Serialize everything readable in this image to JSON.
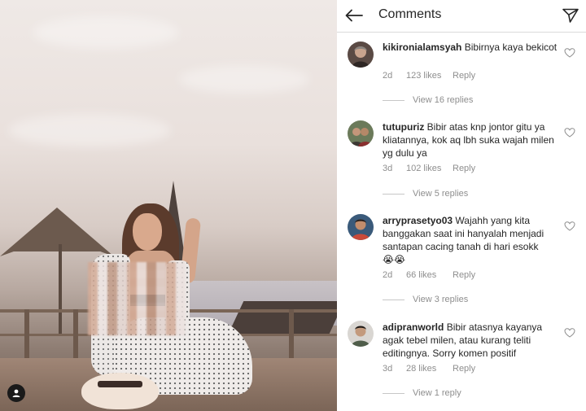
{
  "header": {
    "title": "Comments"
  },
  "comments": [
    {
      "username": "kikironialamsyah",
      "text": "Bibirnya kaya bekicot",
      "time": "2d",
      "likes": "123 likes",
      "reply_label": "Reply",
      "view_replies": "View 16 replies"
    },
    {
      "username": "tutupuriz",
      "text": "Bibir atas knp jontor gitu ya kliatannya, kok aq lbh suka wajah milen yg dulu ya",
      "time": "3d",
      "likes": "102 likes",
      "reply_label": "Reply",
      "view_replies": "View 5 replies"
    },
    {
      "username": "arryprasetyo03",
      "text": "Wajahh yang kita banggakan saat ini hanyalah menjadi santapan cacing tanah di hari esokk",
      "emoji": "😭😭",
      "time": "2d",
      "likes": "66 likes",
      "reply_label": "Reply",
      "view_replies": "View 3 replies"
    },
    {
      "username": "adipranworld",
      "text": "Bibir atasnya kayanya agak tebel milen, atau kurang teliti editingnya. Sorry komen positif",
      "time": "3d",
      "likes": "28 likes",
      "reply_label": "Reply",
      "view_replies": "View 1 reply"
    }
  ],
  "icons": {
    "back": "arrow-left-icon",
    "send": "paper-plane-icon",
    "like": "heart-outline-icon",
    "profile": "user-icon"
  },
  "colors": {
    "text_primary": "#262626",
    "text_secondary": "#8e8e8e",
    "divider": "#dbdbdb"
  }
}
